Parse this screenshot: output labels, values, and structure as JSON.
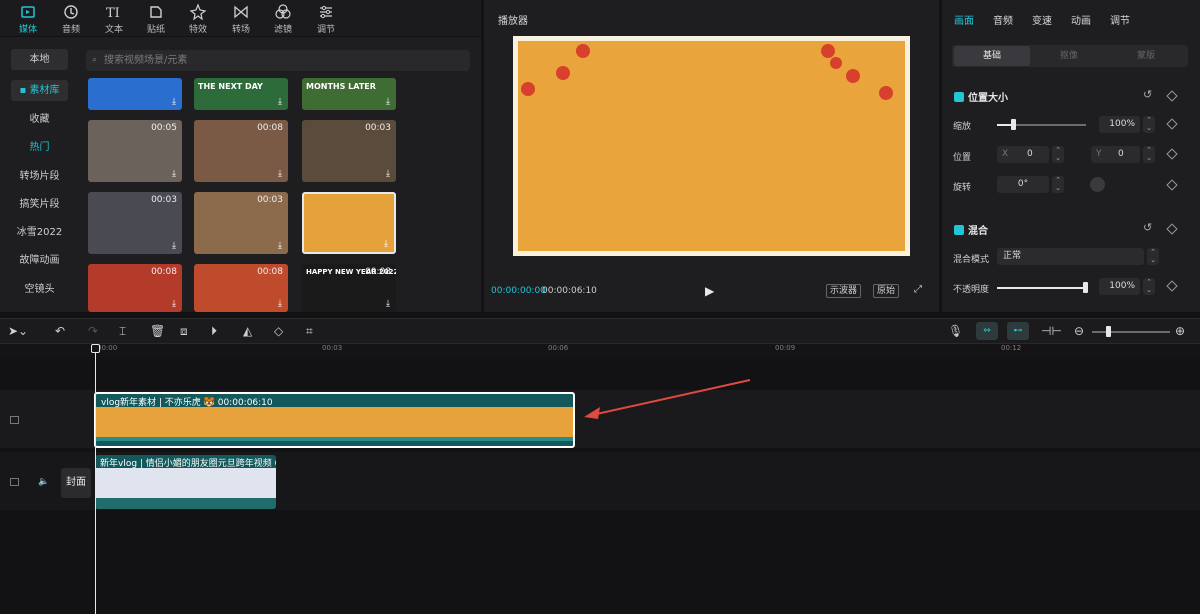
{
  "top_tools": [
    {
      "label": "媒体",
      "icon": "media-icon",
      "active": true
    },
    {
      "label": "音频",
      "icon": "audio-icon"
    },
    {
      "label": "文本",
      "icon": "text-icon"
    },
    {
      "label": "贴纸",
      "icon": "sticker-icon"
    },
    {
      "label": "特效",
      "icon": "effects-icon"
    },
    {
      "label": "转场",
      "icon": "transition-icon"
    },
    {
      "label": "滤镜",
      "icon": "filter-icon"
    },
    {
      "label": "调节",
      "icon": "adjust-icon"
    }
  ],
  "left_nav": [
    "本地",
    "▪ 素材库",
    "收藏",
    "热门",
    "转场片段",
    "搞笑片段",
    "冰雪2022",
    "故障动画",
    "空镜头"
  ],
  "search": {
    "placeholder": "搜索视频场景/元素"
  },
  "thumbs": [
    {
      "dur": "",
      "color": "#2a6fd0"
    },
    {
      "dur": "",
      "color": "#2e6b3a"
    },
    {
      "dur": "",
      "color": "#3f6c32"
    },
    {
      "dur": "00:05",
      "color": "#6b625b"
    },
    {
      "dur": "00:08",
      "color": "#7a5a45"
    },
    {
      "dur": "00:03",
      "color": "#5a4b3d"
    },
    {
      "dur": "00:03",
      "color": "#4a4a52"
    },
    {
      "dur": "00:03",
      "color": "#8c6a4c"
    },
    {
      "dur": "",
      "color": "#e6a23a"
    },
    {
      "dur": "00:08",
      "color": "#b43a2a"
    },
    {
      "dur": "00:08",
      "color": "#c04a2c"
    },
    {
      "dur": "00:08",
      "color": "#1a1a1a"
    }
  ],
  "thumb_texts": {
    "t1": "THE NEXT DAY",
    "t2": "MONTHS LATER",
    "t3": "HAPPY NEW YEAR 2022"
  },
  "player": {
    "title": "播放器",
    "current_time": "00:00:00:00",
    "total_time": "00:00:06:10",
    "btn_scope": "示波器",
    "btn_original": "原始",
    "play_icon": "play-icon",
    "fullscreen_icon": "fullscreen-icon"
  },
  "props": {
    "tabs": [
      "画面",
      "音频",
      "变速",
      "动画",
      "调节"
    ],
    "subtabs": [
      "基础",
      "抠像",
      "蒙版"
    ],
    "section_position": "位置大小",
    "scale_label": "缩放",
    "scale_value": "100%",
    "position_label": "位置",
    "pos_x_label": "X",
    "pos_x": "0",
    "pos_y_label": "Y",
    "pos_y": "0",
    "rotate_label": "旋转",
    "rotate_value": "0°",
    "section_blend": "混合",
    "blend_mode_label": "混合模式",
    "blend_mode_value": "正常",
    "opacity_label": "不透明度",
    "opacity_value": "100%"
  },
  "timeline": {
    "ticks": [
      "00:00",
      "00:03",
      "00:06",
      "00:09",
      "00:12"
    ],
    "clip1_label": "vlog新年素材 | 不亦乐虎 🐯  00:00:06:10",
    "clip2_label": "新年vlog | 情侣小媚的朋友圈元旦跨年视频   00:",
    "cover_label": "封面"
  },
  "colors": {
    "accent": "#22c5d6",
    "clip_teal": "#13595c",
    "clip_orange": "#e8a23b",
    "arrow": "#e04a3f"
  }
}
